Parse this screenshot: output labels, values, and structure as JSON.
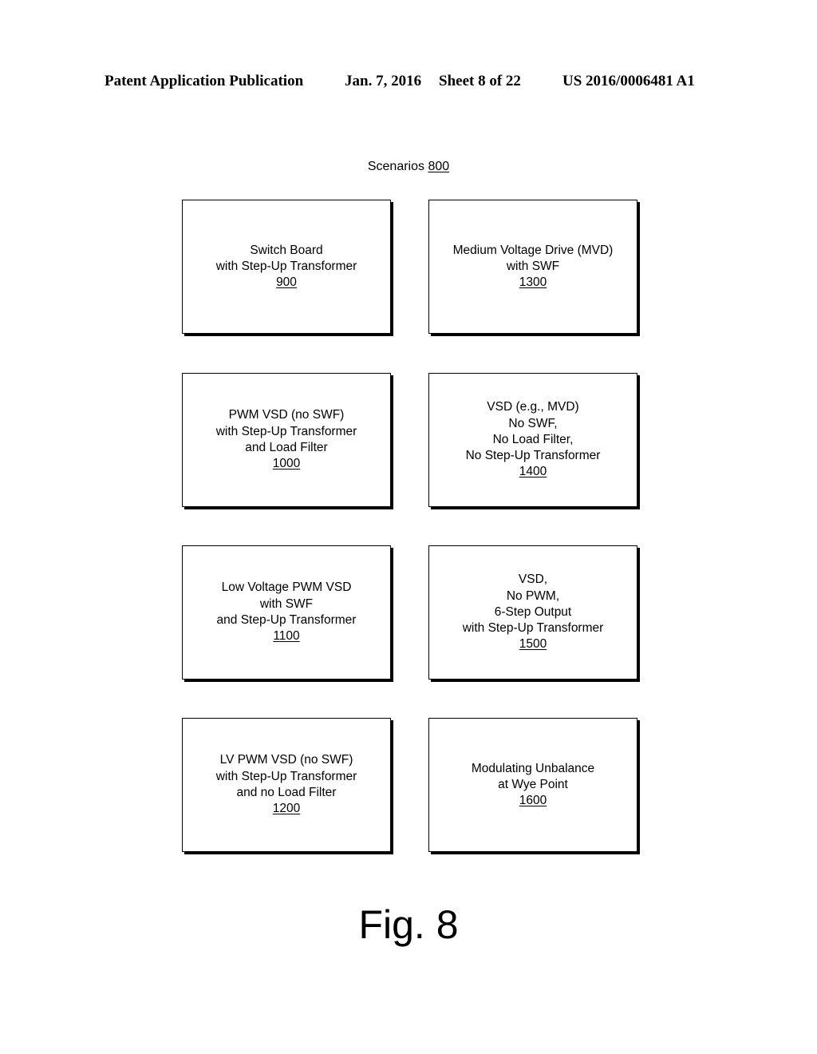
{
  "header": {
    "publication": "Patent Application Publication",
    "date": "Jan. 7, 2016",
    "sheet": "Sheet 8 of 22",
    "number": "US 2016/0006481 A1"
  },
  "diagram": {
    "title": "Scenarios",
    "title_ref": "800",
    "boxes": [
      {
        "lines": [
          "Switch Board",
          "with Step-Up Transformer"
        ],
        "ref": "900"
      },
      {
        "lines": [
          "Medium Voltage Drive (MVD)",
          "with SWF"
        ],
        "ref": "1300"
      },
      {
        "lines": [
          "PWM VSD (no SWF)",
          "with Step-Up Transformer",
          "and Load Filter"
        ],
        "ref": "1000"
      },
      {
        "lines": [
          "VSD (e.g., MVD)",
          "No SWF,",
          "No Load Filter,",
          "No Step-Up Transformer"
        ],
        "ref": "1400"
      },
      {
        "lines": [
          "Low Voltage PWM VSD",
          "with SWF",
          "and Step-Up Transformer"
        ],
        "ref": "1100"
      },
      {
        "lines": [
          "VSD,",
          "No PWM,",
          "6-Step Output",
          "with Step-Up Transformer"
        ],
        "ref": "1500"
      },
      {
        "lines": [
          "LV PWM VSD (no SWF)",
          "with Step-Up Transformer",
          "and no Load Filter"
        ],
        "ref": "1200"
      },
      {
        "lines": [
          "Modulating Unbalance",
          "at Wye Point"
        ],
        "ref": "1600"
      }
    ]
  },
  "figure_label": "Fig. 8"
}
